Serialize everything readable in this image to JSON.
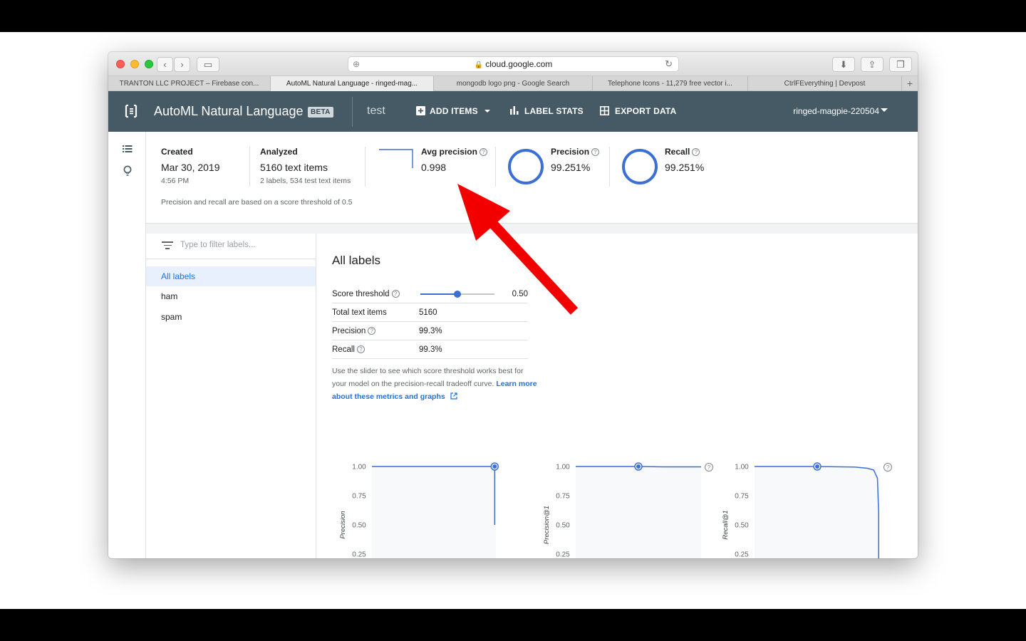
{
  "browser": {
    "url": "cloud.google.com",
    "tabs": [
      {
        "label": "TRANTON LLC PROJECT – Firebase con...",
        "active": false
      },
      {
        "label": "AutoML Natural Language - ringed-mag...",
        "active": true
      },
      {
        "label": "mongodb logo png - Google Search",
        "active": false
      },
      {
        "label": "Telephone Icons - 11,279 free vector i...",
        "active": false
      },
      {
        "label": "CtrlFEverything | Devpost",
        "active": false
      }
    ]
  },
  "header": {
    "title": "AutoML Natural Language",
    "badge": "BETA",
    "model": "test",
    "add_items": "ADD ITEMS",
    "label_stats": "LABEL STATS",
    "export_data": "EXPORT DATA",
    "project": "ringed-magpie-220504"
  },
  "summary": {
    "created_label": "Created",
    "created_date": "Mar 30, 2019",
    "created_time": "4:56 PM",
    "analyzed_label": "Analyzed",
    "analyzed_value": "5160 text items",
    "analyzed_sub": "2 labels, 534 test text items",
    "avg_precision_label": "Avg precision",
    "avg_precision_value": "0.998",
    "precision_label": "Precision",
    "precision_value": "99.251%",
    "recall_label": "Recall",
    "recall_value": "99.251%",
    "note": "Precision and recall are based on a score threshold of 0.5"
  },
  "labels_panel": {
    "filter_placeholder": "Type to filter labels...",
    "items": [
      "All labels",
      "ham",
      "spam"
    ]
  },
  "main": {
    "title": "All labels",
    "score_threshold_label": "Score threshold",
    "score_threshold_value": "0.50",
    "score_threshold_fraction": 0.5,
    "total_label": "Total text items",
    "total_value": "5160",
    "precision_label": "Precision",
    "precision_value": "99.3%",
    "recall_label": "Recall",
    "recall_value": "99.3%",
    "help_text": "Use the slider to see which score threshold works best for your model on the precision-recall tradeoff curve.",
    "help_link": "Learn more about these metrics and graphs"
  },
  "colors": {
    "appbar": "#455a64",
    "accent": "#3b6fd6",
    "arrow": "#f20000"
  },
  "chart_data": [
    {
      "type": "line",
      "ylabel": "Precision",
      "yticks": [
        "1.00",
        "0.75",
        "0.50",
        "0.25"
      ],
      "ylim": [
        0,
        1
      ],
      "points": [
        [
          0,
          1.0
        ],
        [
          0.99,
          1.0
        ],
        [
          0.99,
          0.5
        ]
      ],
      "marker": [
        0.99,
        1.0
      ]
    },
    {
      "type": "line",
      "ylabel": "Precision@1",
      "yticks": [
        "1.00",
        "0.75",
        "0.50",
        "0.25"
      ],
      "ylim": [
        0,
        1
      ],
      "points": [
        [
          0,
          1.0
        ],
        [
          0.5,
          1.0
        ],
        [
          0.7,
          0.997
        ],
        [
          1.0,
          0.997
        ]
      ],
      "marker": [
        0.5,
        1.0
      ]
    },
    {
      "type": "line",
      "ylabel": "Recall@1",
      "yticks": [
        "1.00",
        "0.75",
        "0.50",
        "0.25"
      ],
      "ylim": [
        0,
        1
      ],
      "points": [
        [
          0,
          1.0
        ],
        [
          0.5,
          1.0
        ],
        [
          0.8,
          0.995
        ],
        [
          0.9,
          0.985
        ],
        [
          0.95,
          0.97
        ],
        [
          0.98,
          0.9
        ],
        [
          0.99,
          0.6
        ],
        [
          0.99,
          0.0
        ]
      ],
      "marker": [
        0.5,
        1.0
      ]
    }
  ]
}
